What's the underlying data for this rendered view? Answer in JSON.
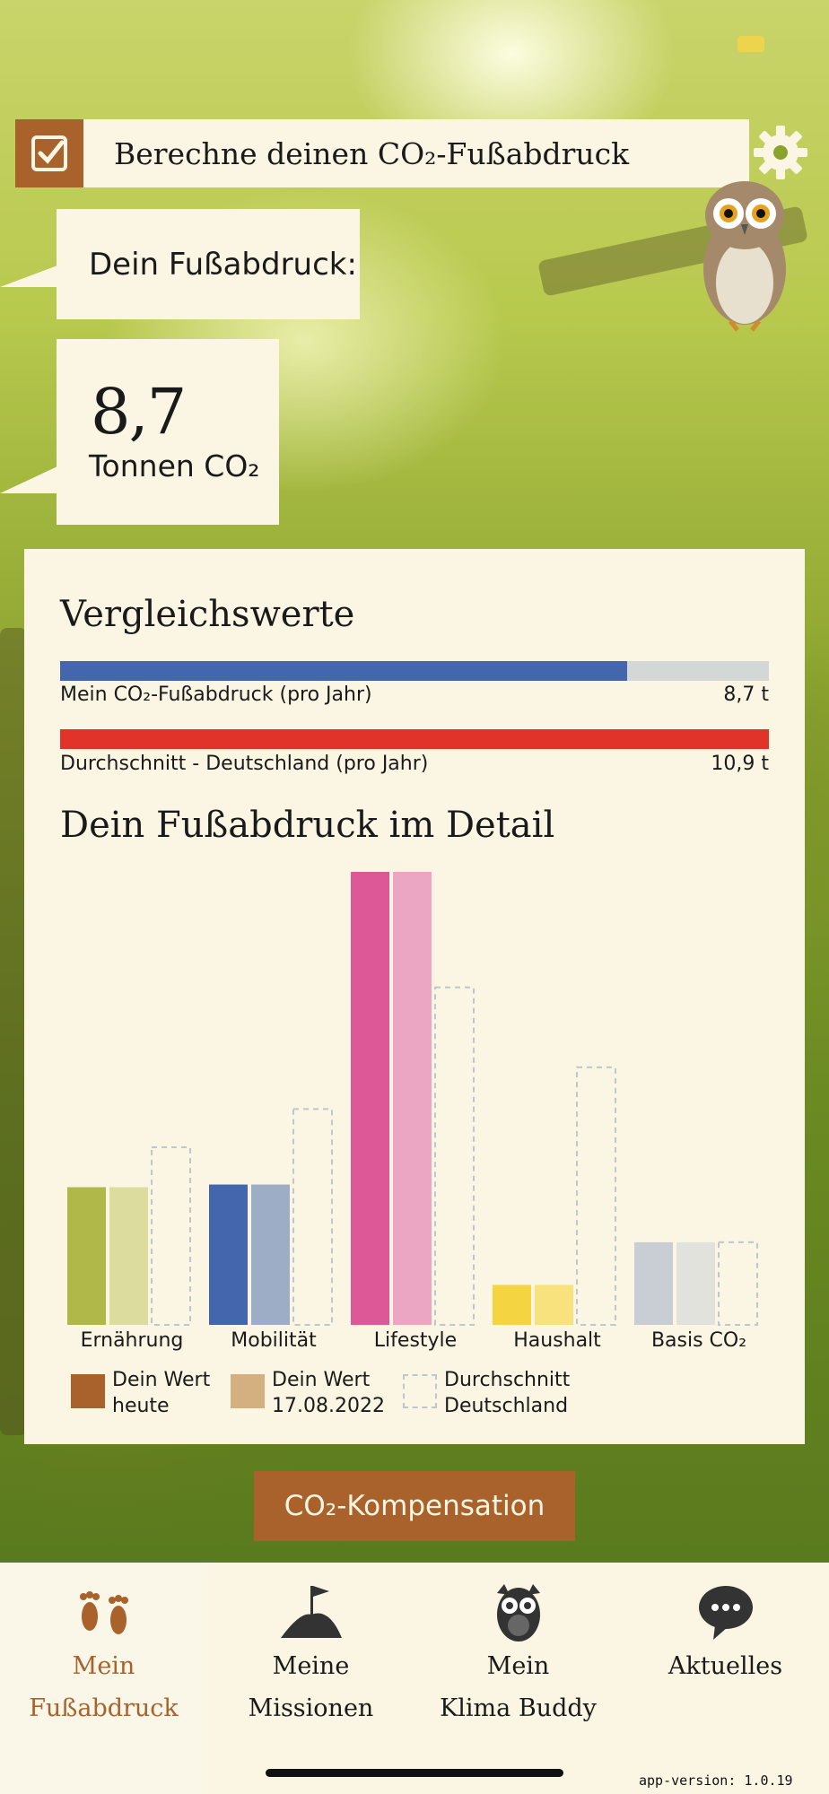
{
  "colors": {
    "brand": "#a9622b",
    "panel": "#fbf6e3",
    "my_bar": "#4466ad",
    "avg_bar": "#e2332a",
    "track": "#d3d7d6"
  },
  "header": {
    "title": "Berechne deinen CO₂-Fußabdruck",
    "check_icon": "checkbox-icon",
    "settings_icon": "gear-icon"
  },
  "footprint": {
    "label": "Dein Fußabdruck:",
    "value": "8,7",
    "unit": "Tonnen CO₂"
  },
  "comparison": {
    "title": "Vergleichswerte",
    "mine": {
      "label": "Mein CO₂-Fußabdruck (pro Jahr)",
      "value_text": "8,7 t",
      "fraction": 0.8
    },
    "average": {
      "label": "Durchschnitt - Deutschland (pro Jahr)",
      "value_text": "10,9 t",
      "fraction": 1.0
    }
  },
  "detail": {
    "title": "Dein Fußabdruck im Detail"
  },
  "chart_data": {
    "type": "bar",
    "title": "Dein Fußabdruck im Detail",
    "categories": [
      "Ernährung",
      "Mobilität",
      "Lifestyle",
      "Haushalt",
      "Basis CO₂"
    ],
    "series": [
      {
        "name": "Dein Wert heute",
        "values": [
          1.55,
          1.58,
          5.1,
          0.45,
          0.93
        ]
      },
      {
        "name": "Dein Wert 17.08.2022",
        "values": [
          1.55,
          1.58,
          5.1,
          0.45,
          0.93
        ]
      },
      {
        "name": "Durchschnitt Deutschland",
        "values": [
          2.0,
          2.43,
          3.8,
          2.9,
          0.93
        ]
      }
    ],
    "category_colors": [
      {
        "today": "#b0b84a",
        "past": "#dcdc9e"
      },
      {
        "today": "#4466ad",
        "past": "#9eadc6"
      },
      {
        "today": "#dc5896",
        "past": "#eaa6c2"
      },
      {
        "today": "#f4d440",
        "past": "#f7e27e"
      },
      {
        "today": "#c9ced4",
        "past": "#e2e2dc"
      }
    ],
    "ylim": [
      0,
      5.1
    ]
  },
  "legend": [
    {
      "line1": "Dein Wert",
      "line2": "heute",
      "color": "#a9622b",
      "style": "solid"
    },
    {
      "line1": "Dein Wert",
      "line2": "17.08.2022",
      "color": "#d4b080",
      "style": "solid"
    },
    {
      "line1": "Durchschnitt",
      "line2": "Deutschland",
      "color": "#bfc6cc",
      "style": "dashed"
    }
  ],
  "cta": {
    "label": "CO₂-Kompensation"
  },
  "nav": [
    {
      "line1": "Mein",
      "line2": "Fußabdruck",
      "icon": "footprints-icon",
      "active": true
    },
    {
      "line1": "Meine",
      "line2": "Missionen",
      "icon": "mountain-flag-icon",
      "active": false
    },
    {
      "line1": "Mein",
      "line2": "Klima Buddy",
      "icon": "owl-icon",
      "active": false
    },
    {
      "line1": "Aktuelles",
      "line2": "",
      "icon": "chat-bubble-icon",
      "active": false
    }
  ],
  "app_version": "app-version: 1.0.19"
}
